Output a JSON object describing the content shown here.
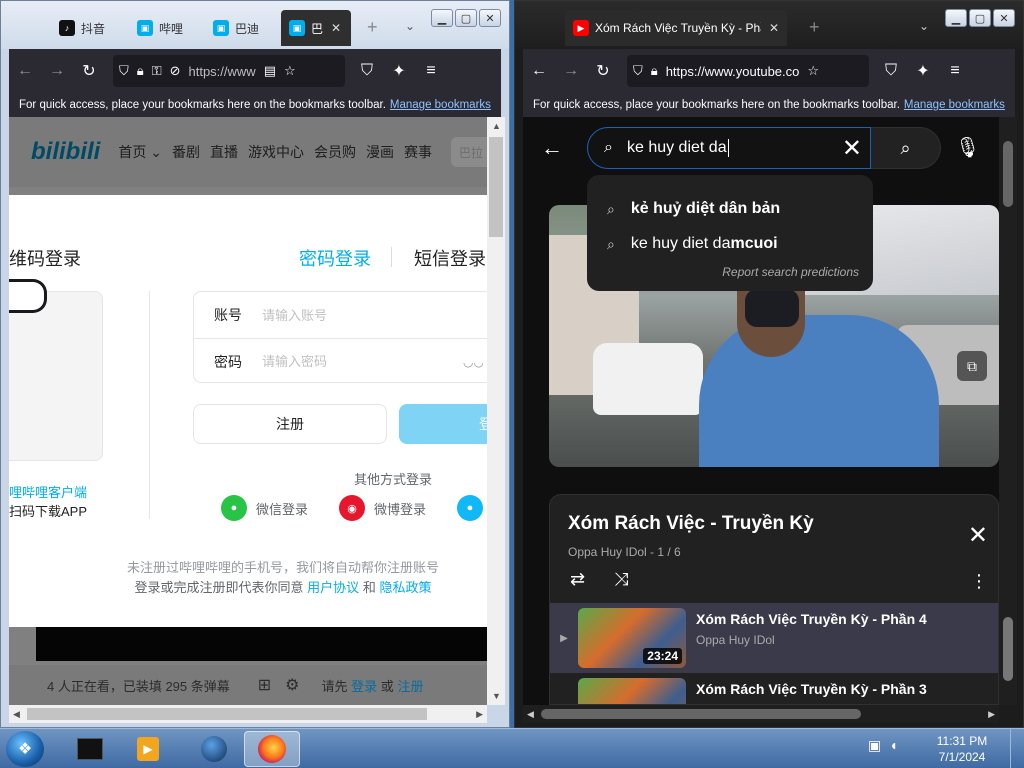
{
  "left_window": {
    "tabs": [
      {
        "label": "抖音",
        "icon": "tiktok-icon",
        "color": "#111111"
      },
      {
        "label": "哔哩",
        "icon": "bilibili-tv-icon",
        "color": "#00aeec"
      },
      {
        "label": "巴迪",
        "icon": "bilibili-tv-icon",
        "color": "#00aeec"
      },
      {
        "label": "巴",
        "icon": "bilibili-tv-icon",
        "color": "#00aeec"
      }
    ],
    "url": "https://www",
    "bookmarks_text": "For quick access, place your bookmarks here on the bookmarks toolbar.",
    "bookmarks_link": "Manage bookmarks",
    "bili_logo": "bilibili",
    "bili_nav": [
      "首页",
      "番剧",
      "直播",
      "游戏中心",
      "会员购",
      "漫画",
      "赛事"
    ],
    "bili_search_placeholder": "巴拉",
    "login": {
      "qr_title": "维码登录",
      "tab_password": "密码登录",
      "tab_sms": "短信登录",
      "qr_line1": "哩哔哩客户端",
      "qr_line2": "扫码下载APP",
      "account_label": "账号",
      "account_placeholder": "请输入账号",
      "password_label": "密码",
      "password_placeholder": "请输入密码",
      "register_button": "注册",
      "login_button": "登",
      "other_methods": "其他方式登录",
      "wechat": "微信登录",
      "weibo": "微博登录",
      "footer_line1": "未注册过哔哩哔哩的手机号，我们将自动帮你注册账号",
      "footer_line2_a": "登录或完成注册即代表你同意",
      "user_agreement": "用户协议",
      "and": "和",
      "privacy_policy": "隐私政策"
    },
    "bottom_bar": {
      "watching": "4 人正在看，已装填 295 条弹幕",
      "please": "请先",
      "login": "登录",
      "or": "或",
      "register": "注册"
    }
  },
  "right_window": {
    "tab_title": "Xóm Rách Việc Truyền Kỳ - Phầ",
    "url": "https://www.youtube.co",
    "bookmarks_text": "For quick access, place your bookmarks here on the bookmarks toolbar.",
    "bookmarks_link": "Manage bookmarks",
    "search_query": "ke huy diet da",
    "suggestions": [
      {
        "prefix": "",
        "bold": "kẻ huỷ diệt dân bản",
        "suffix": ""
      },
      {
        "prefix": "ke huy diet da",
        "bold": "mcuoi",
        "suffix": ""
      }
    ],
    "report_predictions": "Report search predictions",
    "playlist": {
      "title": "Xóm Rách Việc - Truyền Kỳ",
      "meta": "Oppa Huy IDol - 1 / 6",
      "items": [
        {
          "title": "Xóm Rách Việc Truyền Kỳ - Phần 4",
          "channel": "Oppa Huy IDol",
          "duration": "23:24"
        },
        {
          "title": "Xóm Rách Việc Truyền Kỳ - Phần 3",
          "channel": "",
          "duration": ""
        }
      ]
    }
  },
  "taskbar": {
    "time": "11:31 PM",
    "date": "7/1/2024"
  }
}
